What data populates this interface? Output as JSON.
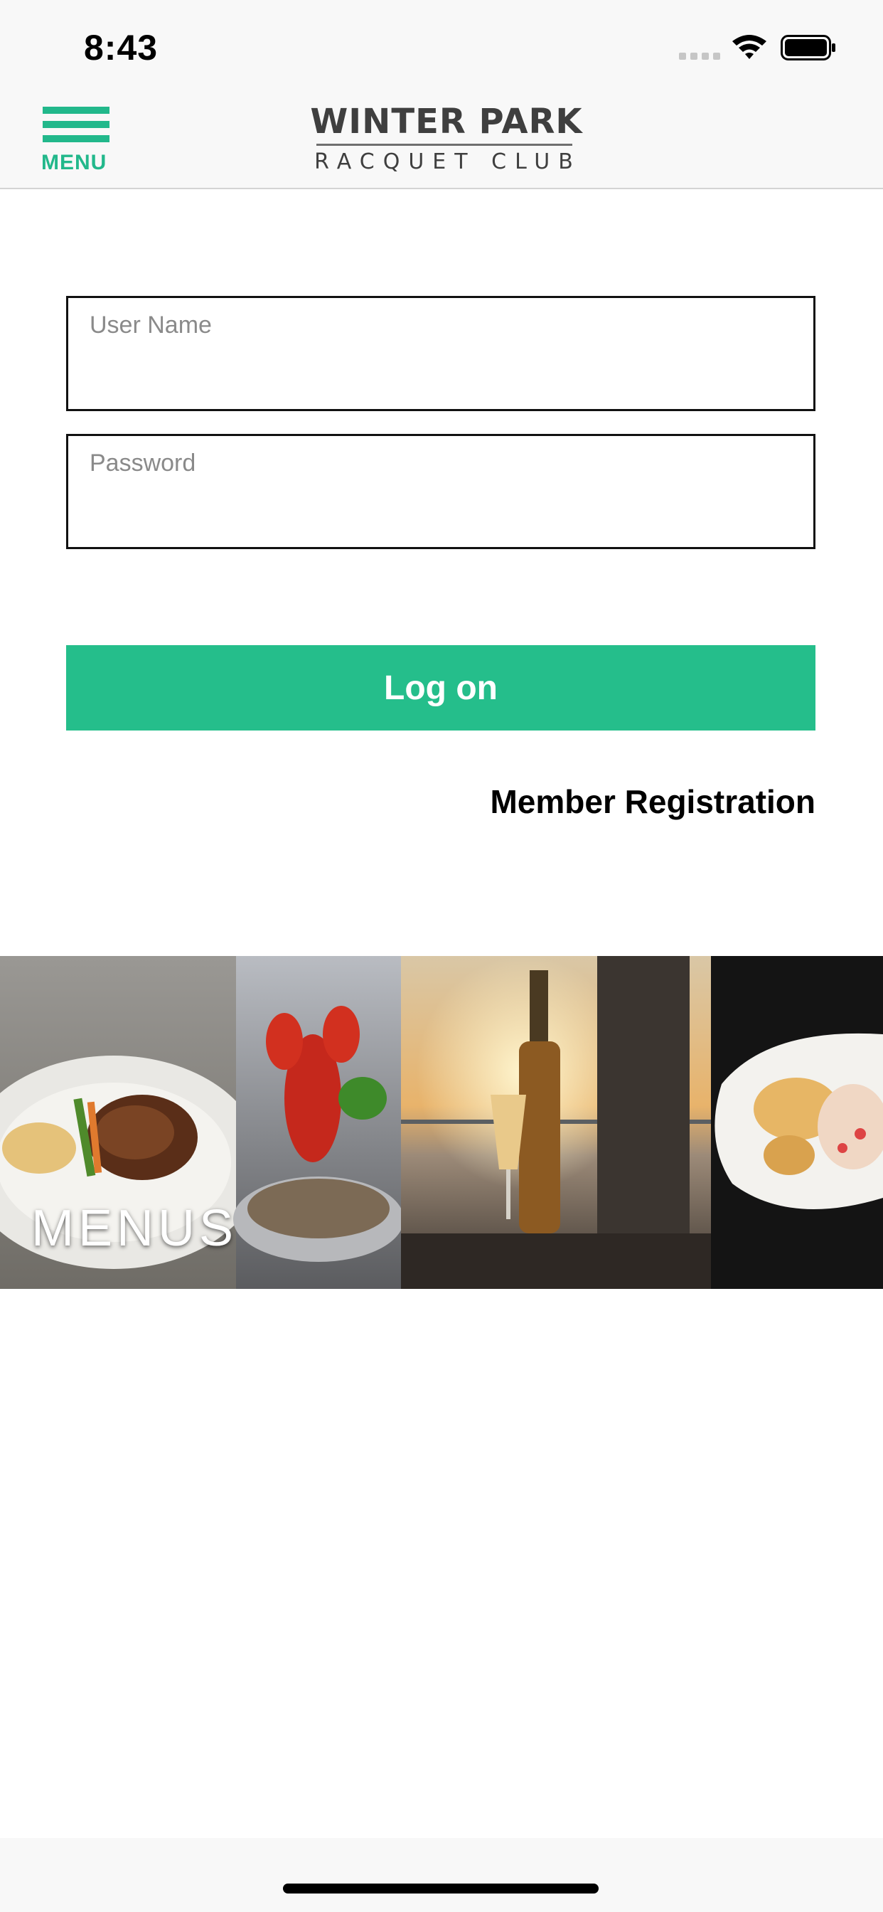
{
  "status_bar": {
    "time": "8:43"
  },
  "header": {
    "menu_label": "MENU",
    "logo_line1": "WINTER PARK",
    "logo_line2": "RACQUET CLUB"
  },
  "login": {
    "username_placeholder": "User Name",
    "password_placeholder": "Password",
    "username_value": "",
    "password_value": "",
    "logon_label": "Log on",
    "member_registration_label": "Member Registration"
  },
  "banner": {
    "label": "MENUS"
  },
  "colors": {
    "accent": "#25be8b",
    "nav_background": "#f8f8f8"
  },
  "icons": [
    "hamburger-icon",
    "wifi-icon",
    "battery-icon",
    "signal-icon"
  ]
}
